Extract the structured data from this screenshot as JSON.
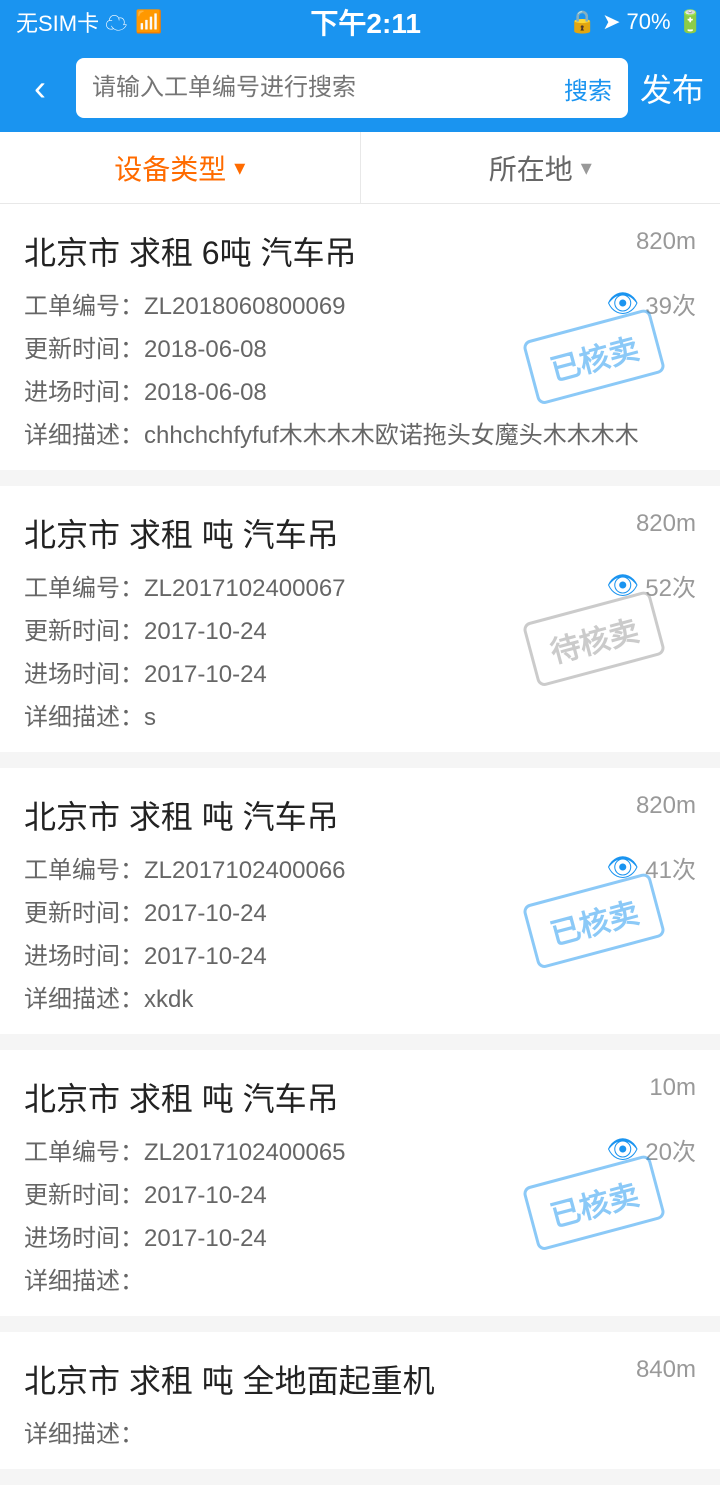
{
  "statusBar": {
    "left": "无SIM卡 ☁",
    "center": "下午2:11",
    "battery": "70%"
  },
  "navBar": {
    "backLabel": "‹",
    "searchPlaceholder": "请输入工单编号进行搜索",
    "searchBtnLabel": "搜索",
    "publishBtnLabel": "发布"
  },
  "filterBar": {
    "deviceTypeLabel": "设备类型",
    "locationLabel": "所在地"
  },
  "listItems": [
    {
      "title": "北京市 求租 6吨 汽车吊",
      "distance": "820m",
      "orderNo": "工单编号：ZL2018060800069",
      "views": "39次",
      "updateTime": "更新时间：2018-06-08",
      "entryTime": "进场时间：2018-06-08",
      "description": "详细描述：chhchchfyfuf木木木木欧诺拖头女魔头木木木木",
      "stampType": "sold",
      "stampText": "已核卖"
    },
    {
      "title": "北京市 求租 吨 汽车吊",
      "distance": "820m",
      "orderNo": "工单编号：ZL2017102400067",
      "views": "52次",
      "updateTime": "更新时间：2017-10-24",
      "entryTime": "进场时间：2017-10-24",
      "description": "详细描述：s",
      "stampType": "pending",
      "stampText": "待核卖"
    },
    {
      "title": "北京市 求租 吨 汽车吊",
      "distance": "820m",
      "orderNo": "工单编号：ZL2017102400066",
      "views": "41次",
      "updateTime": "更新时间：2017-10-24",
      "entryTime": "进场时间：2017-10-24",
      "description": "详细描述：xkdk",
      "stampType": "sold",
      "stampText": "已核卖"
    },
    {
      "title": "北京市 求租 吨 汽车吊",
      "distance": "10m",
      "orderNo": "工单编号：ZL2017102400065",
      "views": "20次",
      "updateTime": "更新时间：2017-10-24",
      "entryTime": "进场时间：2017-10-24",
      "description": "详细描述：",
      "stampType": "sold",
      "stampText": "已核卖"
    },
    {
      "title": "北京市 求租 吨 全地面起重机",
      "distance": "840m",
      "orderNo": "",
      "views": "",
      "updateTime": "",
      "entryTime": "",
      "description": "",
      "stampType": "none",
      "stampText": ""
    }
  ]
}
